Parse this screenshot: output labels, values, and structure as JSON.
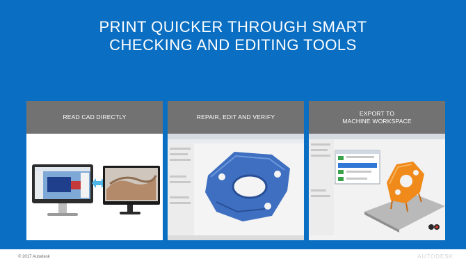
{
  "slide": {
    "title": "PRINT QUICKER THROUGH SMART\nCHECKING AND EDITING TOOLS",
    "panels": [
      {
        "label": "READ CAD DIRECTLY"
      },
      {
        "label": "REPAIR, EDIT AND VERIFY"
      },
      {
        "label": "EXPORT TO\nMACHINE WORKSPACE"
      }
    ]
  },
  "footer": {
    "copyright": "© 2017 Autodesk",
    "logo_text": "AUTODESK"
  },
  "colors": {
    "background": "#0a6fc2",
    "panel_header": "#727272",
    "part_blue": "#3f6fc0",
    "part_orange": "#f08a1a"
  }
}
